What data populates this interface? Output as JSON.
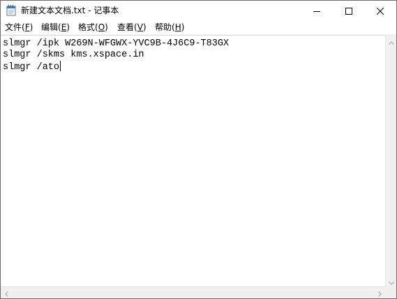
{
  "window": {
    "title": "新建文本文档.txt - 记事本",
    "app_icon": "notepad-icon",
    "controls": {
      "minimize_icon": "minimize-icon",
      "maximize_icon": "maximize-icon",
      "close_icon": "close-icon"
    }
  },
  "menubar": {
    "items": [
      {
        "label": "文件(",
        "key": "F",
        "tail": ")"
      },
      {
        "label": "编辑(",
        "key": "E",
        "tail": ")"
      },
      {
        "label": "格式(",
        "key": "O",
        "tail": ")"
      },
      {
        "label": "查看(",
        "key": "V",
        "tail": ")"
      },
      {
        "label": "帮助(",
        "key": "H",
        "tail": ")"
      }
    ]
  },
  "editor": {
    "lines": [
      "slmgr /ipk W269N-WFGWX-YVC9B-4J6C9-T83GX",
      "slmgr /skms kms.xspace.in",
      "slmgr /ato"
    ]
  },
  "scrollbars": {
    "vertical": {
      "up_icon": "scroll-up-arrow-icon",
      "down_icon": "scroll-down-arrow-icon"
    },
    "horizontal": {
      "left_icon": "scroll-left-arrow-icon",
      "right_icon": "scroll-right-arrow-icon"
    }
  }
}
